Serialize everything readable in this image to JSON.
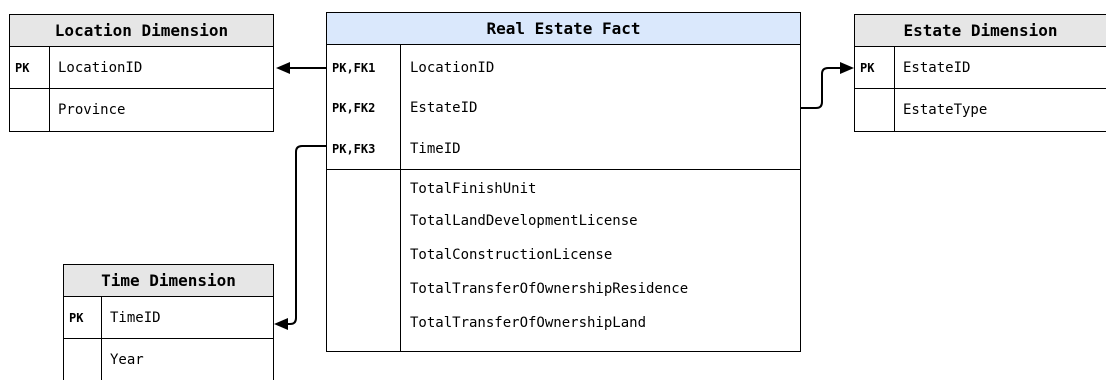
{
  "location_dimension": {
    "title": "Location Dimension",
    "rows": [
      {
        "key": "PK",
        "field": "LocationID"
      },
      {
        "key": "",
        "field": "Province"
      }
    ]
  },
  "real_estate_fact": {
    "title": "Real Estate Fact",
    "keys": [
      {
        "key": "PK,FK1",
        "field": "LocationID"
      },
      {
        "key": "PK,FK2",
        "field": "EstateID"
      },
      {
        "key": "PK,FK3",
        "field": "TimeID"
      }
    ],
    "measures": [
      "TotalFinishUnit",
      "TotalLandDevelopmentLicense",
      "TotalConstructionLicense",
      "TotalTransferOfOwnershipResidence",
      "TotalTransferOfOwnershipLand"
    ]
  },
  "estate_dimension": {
    "title": "Estate Dimension",
    "rows": [
      {
        "key": "PK",
        "field": "EstateID"
      },
      {
        "key": "",
        "field": "EstateType"
      }
    ]
  },
  "time_dimension": {
    "title": "Time Dimension",
    "rows": [
      {
        "key": "PK",
        "field": "TimeID"
      },
      {
        "key": "",
        "field": "Year"
      }
    ]
  },
  "colors": {
    "dimension_header": "#e6e6e6",
    "fact_header": "#dae8fc",
    "border": "#000000"
  }
}
